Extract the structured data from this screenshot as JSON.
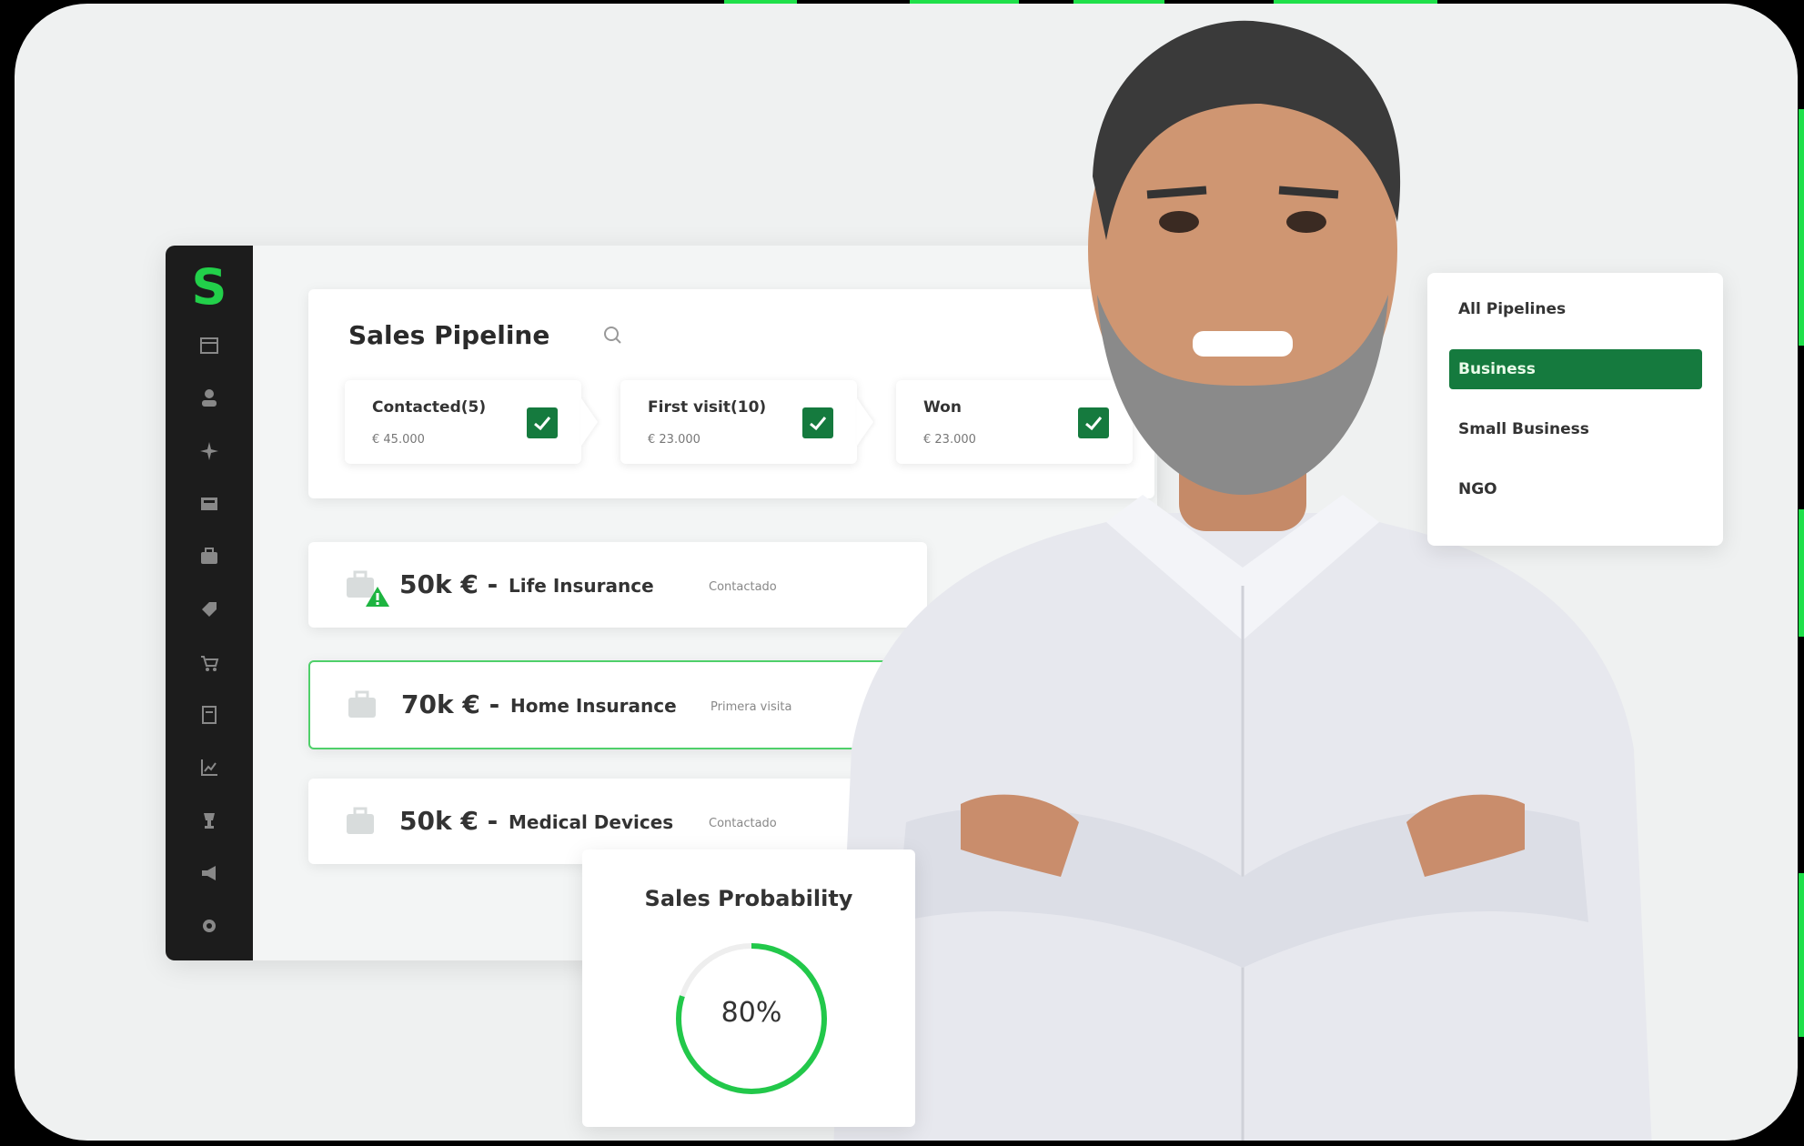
{
  "app": {
    "logo": "S",
    "sidebar_icons": [
      "calendar-icon",
      "user-icon",
      "plane-icon",
      "inbox-icon",
      "briefcase-icon",
      "tag-icon",
      "cart-icon",
      "document-icon",
      "chart-icon",
      "trophy-icon",
      "megaphone-icon",
      "settings-icon"
    ]
  },
  "pipeline": {
    "title": "Sales Pipeline",
    "stages": [
      {
        "name": "Contacted(5)",
        "amount": "€ 45.000"
      },
      {
        "name": "First visit(10)",
        "amount": "€ 23.000"
      },
      {
        "name": "Won",
        "amount": "€ 23.000"
      }
    ]
  },
  "deals": [
    {
      "value": "50k € -",
      "name": "Life Insurance",
      "status": "Contactado",
      "warning": true
    },
    {
      "value": "70k € -",
      "name": "Home Insurance",
      "status": "Primera visita",
      "warning": false
    },
    {
      "value": "50k € -",
      "name": "Medical Devices",
      "status": "Contactado",
      "warning": false
    }
  ],
  "probability": {
    "title": "Sales Probability",
    "value_text": "80%",
    "value": 0.8
  },
  "pipeline_filter": {
    "items": [
      "All Pipelines",
      "Business",
      "Small Business",
      "NGO"
    ],
    "selected": "Business"
  },
  "colors": {
    "accent": "#1fe04a",
    "brand_green": "#157a3e",
    "sidebar": "#1c1c1c"
  }
}
